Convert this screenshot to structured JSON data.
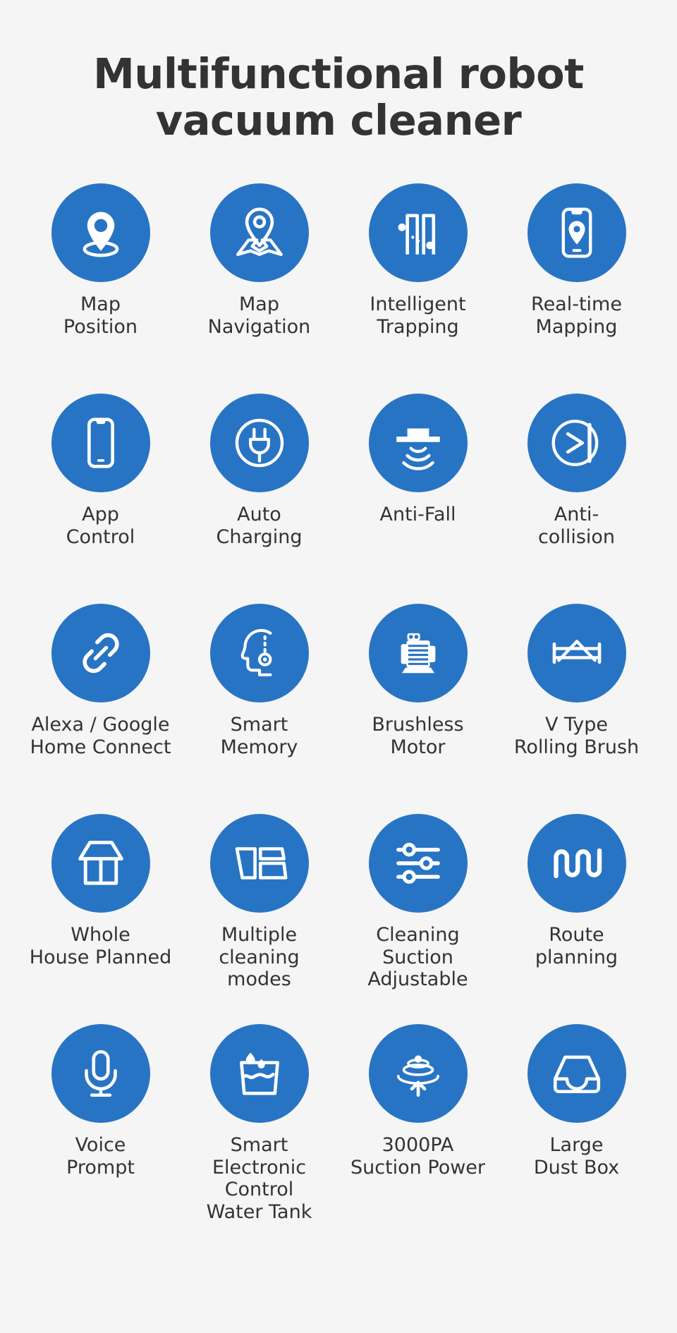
{
  "header": {
    "title": "Multifunctional robot\nvacuum cleaner"
  },
  "theme": {
    "background": "#f5f5f5",
    "badge_blue": "#2874C4",
    "icon_white": "#ffffff",
    "text_dark": "#333333"
  },
  "features": [
    {
      "id": 1,
      "icon": "map-pin-position-icon",
      "label": "Map\nPosition"
    },
    {
      "id": 2,
      "icon": "map-navigation-icon",
      "label": "Map\nNavigation"
    },
    {
      "id": 3,
      "icon": "intelligent-trapping-icon",
      "label": "Intelligent\nTrapping"
    },
    {
      "id": 4,
      "icon": "realtime-mapping-phone-icon",
      "label": "Real-time\nMapping"
    },
    {
      "id": 5,
      "icon": "smartphone-icon",
      "label": "App\nControl"
    },
    {
      "id": 6,
      "icon": "power-plug-circle-icon",
      "label": "Auto\nCharging"
    },
    {
      "id": 7,
      "icon": "anti-fall-sensor-icon",
      "label": "Anti-Fall"
    },
    {
      "id": 8,
      "icon": "anti-collision-icon",
      "label": "Anti-\ncollision"
    },
    {
      "id": 9,
      "icon": "chain-link-icon",
      "label": "Alexa / Google\nHome Connect"
    },
    {
      "id": 10,
      "icon": "smart-memory-head-icon",
      "label": "Smart\nMemory"
    },
    {
      "id": 11,
      "icon": "brushless-motor-icon",
      "label": "Brushless\nMotor"
    },
    {
      "id": 12,
      "icon": "v-type-rolling-brush-icon",
      "label": "V Type\nRolling Brush"
    },
    {
      "id": 13,
      "icon": "house-planned-icon",
      "label": "Whole\nHouse Planned"
    },
    {
      "id": 14,
      "icon": "multiple-modes-panels-icon",
      "label": "Multiple\ncleaning\nmodes"
    },
    {
      "id": 15,
      "icon": "sliders-adjust-icon",
      "label": "Cleaning\nSuction\nAdjustable"
    },
    {
      "id": 16,
      "icon": "serpentine-route-icon",
      "label": "Route\nplanning"
    },
    {
      "id": 17,
      "icon": "microphone-icon",
      "label": "Voice\nPrompt"
    },
    {
      "id": 18,
      "icon": "water-tank-icon",
      "label": "Smart\nElectronic Control\nWater Tank"
    },
    {
      "id": 19,
      "icon": "suction-vortex-icon",
      "label": "3000PA\nSuction Power"
    },
    {
      "id": 20,
      "icon": "dust-box-tray-icon",
      "label": "Large\nDust Box"
    }
  ]
}
